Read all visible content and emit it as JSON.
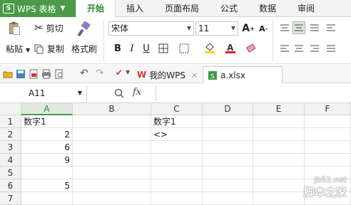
{
  "app": {
    "title": "WPS 表格"
  },
  "menu": {
    "tabs": [
      "开始",
      "插入",
      "页面布局",
      "公式",
      "数据",
      "审阅"
    ],
    "active": "开始"
  },
  "ribbon": {
    "paste": "粘贴",
    "cut": "剪切",
    "copy": "复制",
    "format_painter": "格式刷",
    "font": "宋体",
    "size": "11",
    "bold": "B",
    "italic": "I",
    "underline": "U",
    "grow": "A",
    "shrink": "A"
  },
  "doc_tabs": [
    {
      "label": "我的WPS"
    },
    {
      "label": "a.xlsx"
    }
  ],
  "formula_bar": {
    "name_box": "A11",
    "fx": "fx",
    "content": ""
  },
  "grid": {
    "columns": [
      "A",
      "B",
      "C",
      "D",
      "E",
      "F"
    ],
    "selected_column": "A",
    "rows": [
      "1",
      "2",
      "3",
      "4",
      "5",
      "6",
      "7"
    ],
    "cells": {
      "A1": "数字1",
      "A2": "2",
      "A3": "6",
      "A4": "9",
      "A6": "5",
      "C1": "数字1",
      "C2": "<>"
    }
  },
  "watermark": {
    "line1": "jb51.net",
    "line2": "脚本之家"
  },
  "colors": {
    "accent": "#4a9a4a",
    "active_tab_text": "#2f8a2f"
  }
}
